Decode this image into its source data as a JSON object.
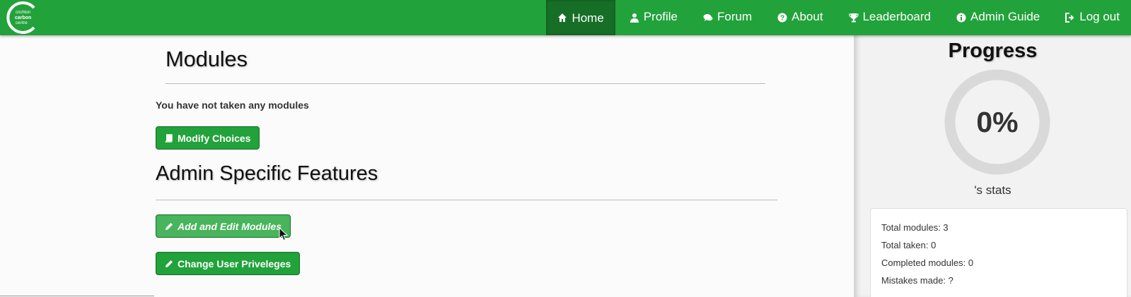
{
  "brand": {
    "logo_text_lines": [
      "crichton",
      "carbon",
      "centre"
    ]
  },
  "nav": {
    "items": [
      {
        "label": "Home",
        "icon": "home-icon",
        "active": true
      },
      {
        "label": "Profile",
        "icon": "user-icon"
      },
      {
        "label": "Forum",
        "icon": "comments-icon"
      },
      {
        "label": "About",
        "icon": "question-circle-icon"
      },
      {
        "label": "Leaderboard",
        "icon": "trophy-icon"
      },
      {
        "label": "Admin Guide",
        "icon": "info-circle-icon"
      },
      {
        "label": "Log out",
        "icon": "sign-out-icon"
      }
    ]
  },
  "main": {
    "modules_title": "Modules",
    "no_modules_text": "You have not taken any modules",
    "modify_button": "Modify Choices",
    "admin_title": "Admin Specific Features",
    "add_edit_button": "Add and Edit Modules",
    "change_user_button": "Change User Priveleges"
  },
  "sidebar": {
    "progress_title": "Progress",
    "progress_percent": "0%",
    "progress_value": 0,
    "stats_title": "'s stats",
    "stats": [
      "Total modules: 3",
      "Total taken: 0",
      "Completed modules: 0",
      "Mistakes made: ?"
    ]
  },
  "colors": {
    "brand_green": "#22a23b",
    "active_green": "#176f27",
    "hover_green": "#48b45c"
  }
}
